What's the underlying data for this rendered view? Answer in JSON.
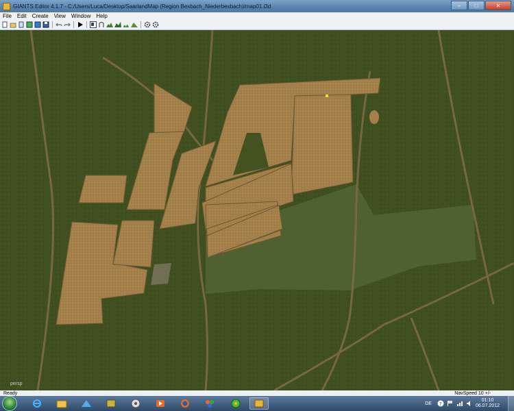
{
  "window": {
    "title": "GIANTS Editor 4.1.7 - C:/Users/Luca/Desktop/SaarlandMap (Region Bexbach_Niederbexbach)/map01.i3d",
    "controls": [
      "–",
      "□",
      "✕"
    ]
  },
  "menu": [
    "File",
    "Edit",
    "Create",
    "View",
    "Window",
    "Help"
  ],
  "toolbar": {
    "icons": [
      "new-file-icon",
      "open-file-icon",
      "document-icon",
      "export-icon",
      "import-icon",
      "save-icon",
      "undo-icon",
      "redo-icon",
      "play-icon",
      "select-icon",
      "move-icon",
      "terrain-icon",
      "paint-icon",
      "foliage-icon",
      "paint-terrain-icon",
      "settings-icon",
      "settings-alt-icon"
    ]
  },
  "viewport": {
    "camera_label": "persp"
  },
  "status": {
    "text": "Ready",
    "navspeed": "NavSpeed 10 +/-"
  },
  "taskbar": {
    "apps": [
      "internet-explorer-icon",
      "file-explorer-icon",
      "network-icon",
      "archive-icon",
      "media-center-icon",
      "media-player-icon",
      "firefox-icon",
      "paint-icon",
      "icq-icon",
      "giants-editor-icon"
    ],
    "language": "DE",
    "time": "01:10",
    "date": "06.07.2012"
  },
  "colors": {
    "field": "#a3804a",
    "grass": "#3f4f1f",
    "grass_light": "#556638",
    "road": "#7c6a45",
    "taskbar": "#2f4a68"
  }
}
